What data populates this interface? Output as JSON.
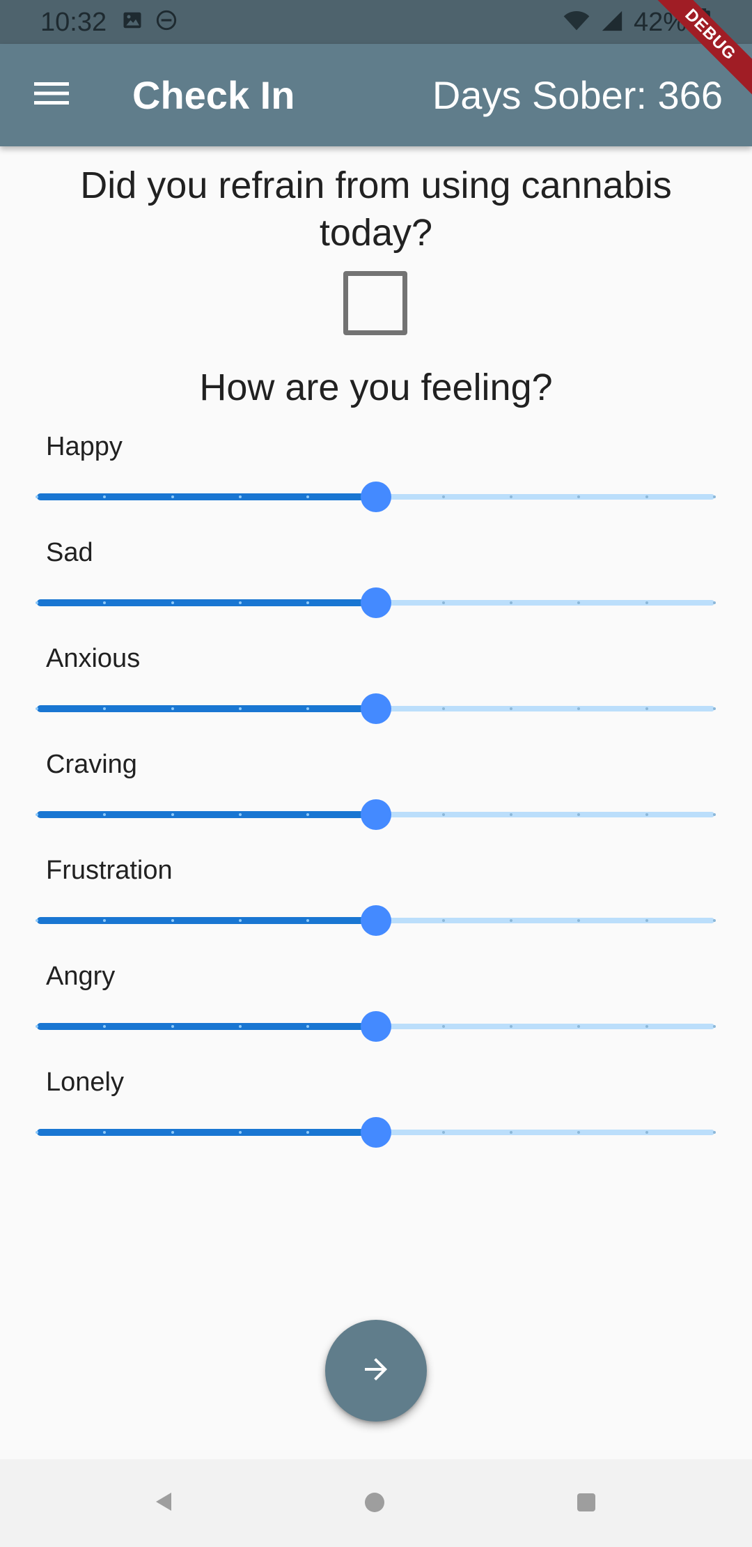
{
  "status_bar": {
    "time": "10:32",
    "battery": "42%",
    "icons_left": [
      "image-icon",
      "do-not-disturb-icon"
    ],
    "icons_right": [
      "wifi-icon",
      "signal-icon",
      "battery-icon"
    ]
  },
  "debug_banner": {
    "label": "DEBUG"
  },
  "app_bar": {
    "menu_icon": "menu-icon",
    "title": "Check In",
    "days_sober": "Days Sober: 366"
  },
  "main": {
    "question": "Did you refrain from using cannabis today?",
    "checkbox_checked": false,
    "feeling_heading": "How are you feeling?",
    "slider_scale": {
      "min": 0,
      "max": 10,
      "divisions": 10
    },
    "sliders": [
      {
        "label": "Happy",
        "value": 5
      },
      {
        "label": "Sad",
        "value": 5
      },
      {
        "label": "Anxious",
        "value": 5
      },
      {
        "label": "Craving",
        "value": 5
      },
      {
        "label": "Frustration",
        "value": 5
      },
      {
        "label": "Angry",
        "value": 5
      },
      {
        "label": "Lonely",
        "value": 5
      }
    ]
  },
  "fab": {
    "icon": "arrow-forward-icon"
  },
  "nav_bar": {
    "icons": [
      "back-icon",
      "home-icon",
      "recents-icon"
    ]
  },
  "colors": {
    "app_bar": "#607d8b",
    "status_bar": "#4e636d",
    "slider_active": "#1976d2",
    "slider_inactive": "#bbdefb",
    "slider_thumb": "#448aff",
    "debug_banner": "#a01d25"
  }
}
